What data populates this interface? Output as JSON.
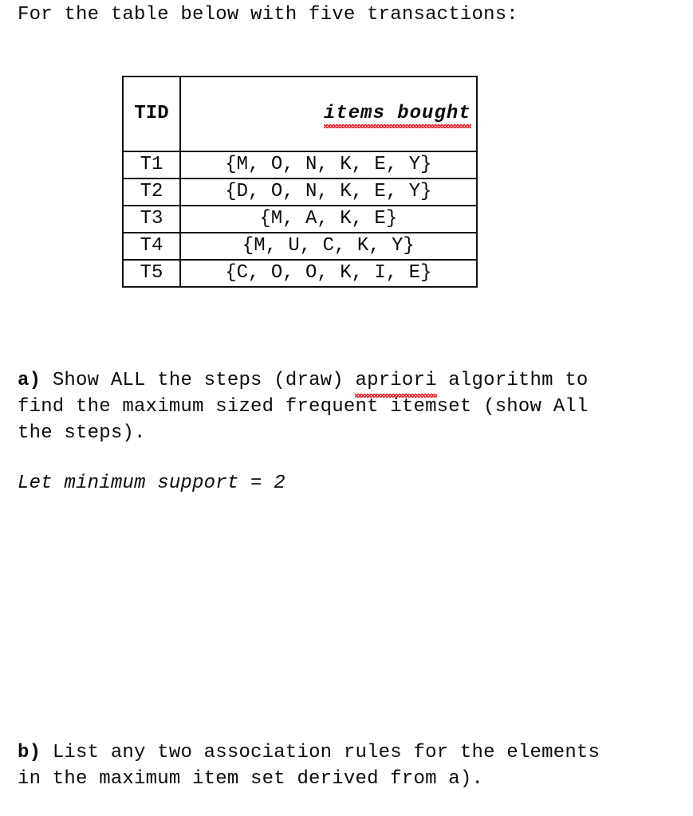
{
  "document": {
    "intro": "For the table below with five transactions:",
    "table": {
      "caption_tid": "TID",
      "caption_items": "items bought",
      "rows": [
        {
          "tid": "T1",
          "items": "{M, O, N, K, E, Y}"
        },
        {
          "tid": "T2",
          "items": "{D, O, N, K, E, Y}"
        },
        {
          "tid": "T3",
          "items": "{M, A, K, E}"
        },
        {
          "tid": "T4",
          "items": "{M, U, C, K, Y}"
        },
        {
          "tid": "T5",
          "items": "{C, O, O, K, I, E}"
        }
      ]
    },
    "question_a": {
      "label": "a)",
      "text_part1": " Show ALL the steps (draw) ",
      "misspelled_word": "apriori",
      "text_part2": " algorithm to",
      "line2": "find the maximum sized frequent itemset (show All",
      "line3": "the steps)."
    },
    "note": "Let minimum support = 2",
    "question_b": {
      "label": "b)",
      "line1": " List any two association rules for the elements",
      "line2": "in the maximum item set derived from a)."
    },
    "colors": {
      "text": "#0b0b0b",
      "spellcheck_underline": "#e8232a",
      "table_border": "#111111",
      "background": "#ffffff"
    }
  }
}
